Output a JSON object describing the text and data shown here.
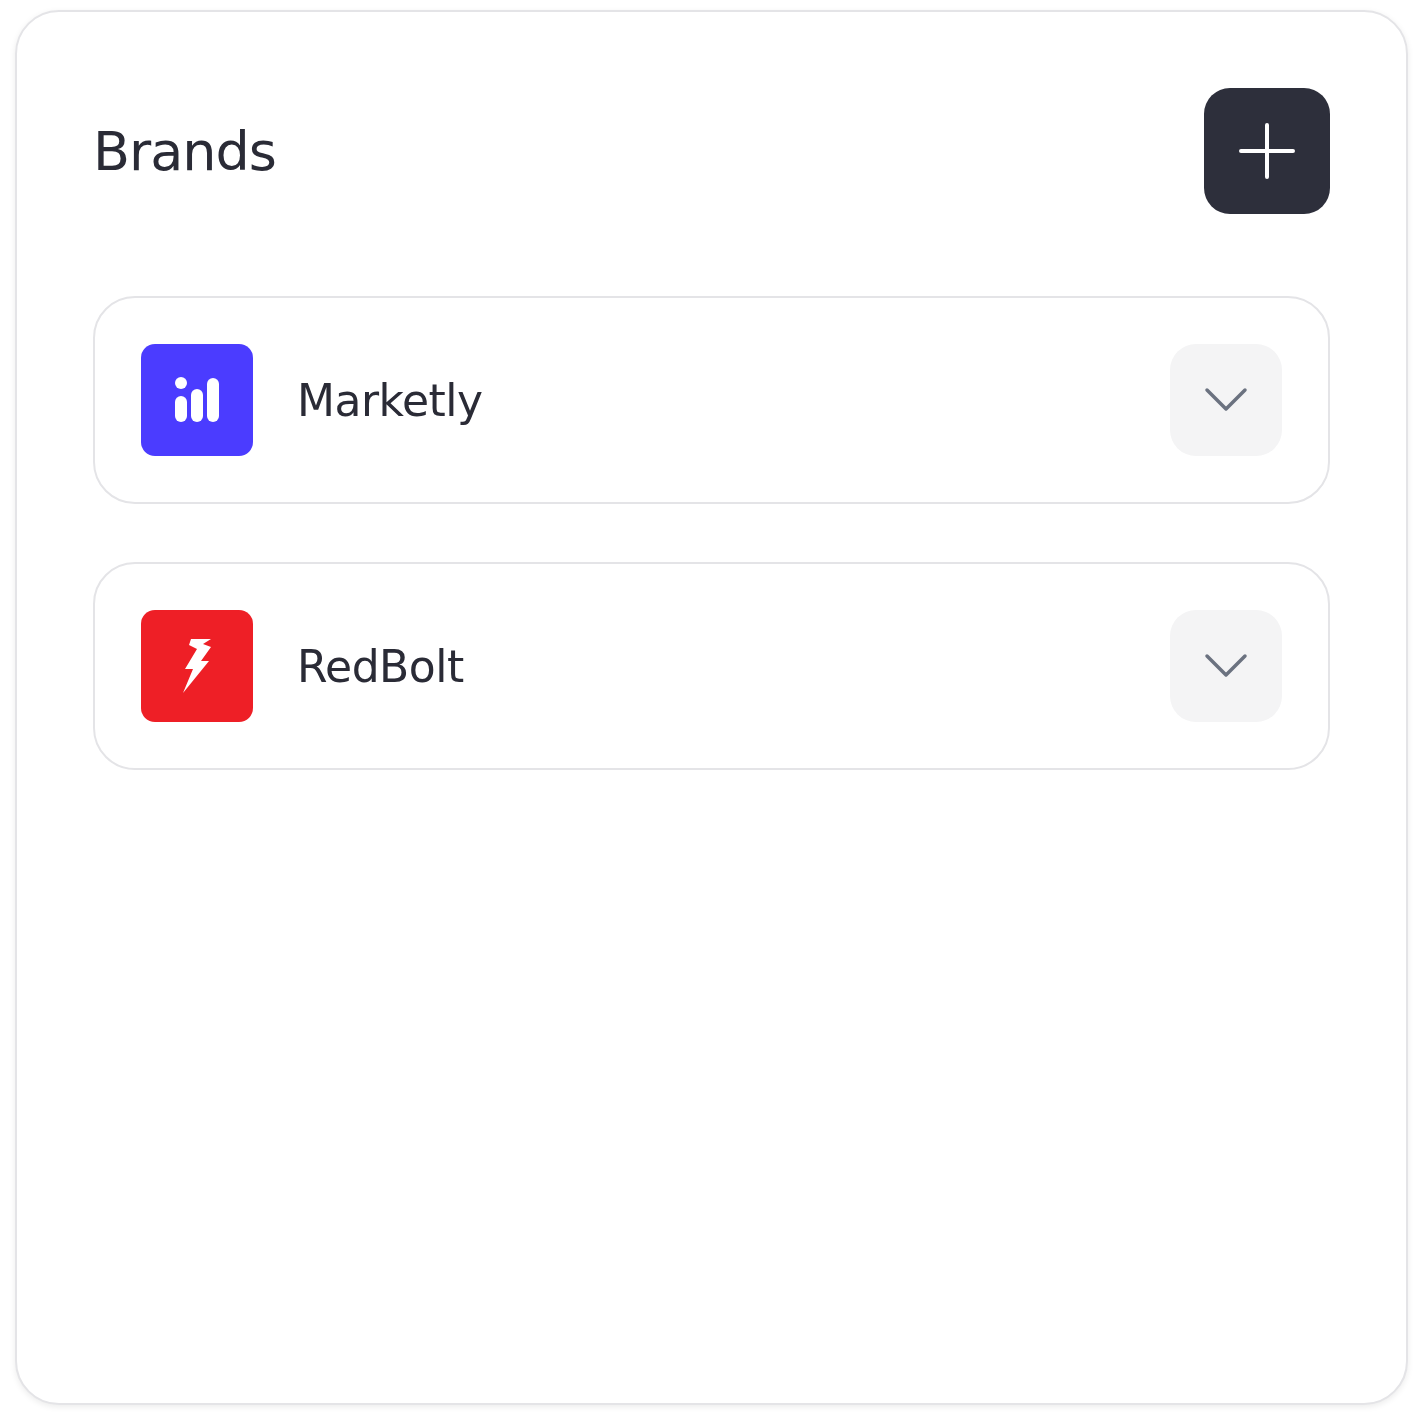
{
  "header": {
    "title": "Brands"
  },
  "brands": [
    {
      "name": "Marketly",
      "kind": "bars",
      "color": "#4b3cff",
      "expanded": false
    },
    {
      "name": "RedBolt",
      "kind": "bolt",
      "color": "#ee1f26",
      "expanded": false
    }
  ]
}
